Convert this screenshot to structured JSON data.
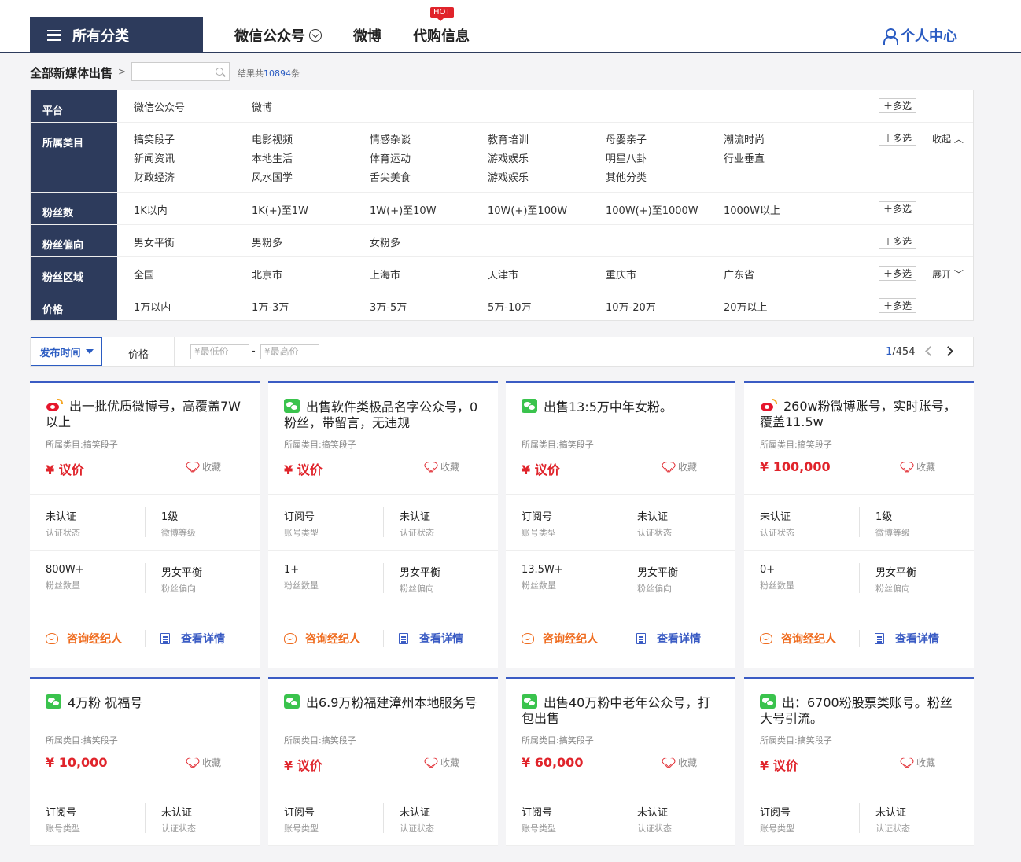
{
  "nav": {
    "all_categories": "所有分类",
    "items": [
      "微信公众号",
      "微博",
      "代购信息"
    ],
    "hot_badge": "HOT",
    "user_center": "个人中心"
  },
  "breadcrumb": {
    "title": "全部新媒体出售",
    "arrow": ">",
    "search_placeholder": "",
    "result_prefix": "结果共",
    "result_count": "10894",
    "result_suffix": "条"
  },
  "filters": {
    "multi_label": "多选",
    "collapse_label": "收起",
    "expand_label": "展开",
    "platform": {
      "label": "平台",
      "options": [
        "微信公众号",
        "微博"
      ]
    },
    "category": {
      "label": "所属类目",
      "options": [
        "搞笑段子",
        "电影视频",
        "情感杂谈",
        "教育培训",
        "母婴亲子",
        "潮流时尚",
        "新闻资讯",
        "本地生活",
        "体育运动",
        "游戏娱乐",
        "明星八卦",
        "行业垂直",
        "财政经济",
        "风水国学",
        "舌尖美食",
        "游戏娱乐",
        "其他分类"
      ]
    },
    "fans": {
      "label": "粉丝数",
      "options": [
        "1K以内",
        "1K(+)至1W",
        "1W(+)至10W",
        "10W(+)至100W",
        "100W(+)至1000W",
        "1000W以上"
      ]
    },
    "gender": {
      "label": "粉丝偏向",
      "options": [
        "男女平衡",
        "男粉多",
        "女粉多"
      ]
    },
    "region": {
      "label": "粉丝区域",
      "options": [
        "全国",
        "北京市",
        "上海市",
        "天津市",
        "重庆市",
        "广东省"
      ]
    },
    "price": {
      "label": "价格",
      "options": [
        "1万以内",
        "1万-3万",
        "3万-5万",
        "5万-10万",
        "10万-20万",
        "20万以上"
      ]
    }
  },
  "sortbar": {
    "sort_label": "发布时间",
    "price_label": "价格",
    "min_placeholder": "¥最低价",
    "max_placeholder": "¥最高价",
    "dash": "-",
    "page_current": "1",
    "page_total": "/454"
  },
  "card_labels": {
    "favorite": "收藏",
    "consult": "咨询经纪人",
    "detail": "查看详情"
  },
  "cards": [
    {
      "platform_icon": "weibo-icon",
      "title": "出一批优质微博号，高覆盖7W以上",
      "category": "所属类目:搞笑段子",
      "price": "¥ 议价",
      "attrs": [
        [
          "未认证",
          "认证状态"
        ],
        [
          "1级",
          "微博等级"
        ],
        [
          "800W+",
          "粉丝数量"
        ],
        [
          "男女平衡",
          "粉丝偏向"
        ]
      ]
    },
    {
      "platform_icon": "wechat-icon",
      "title": "出售软件类极品名字公众号，0粉丝，带留言，无违规",
      "category": "所属类目:搞笑段子",
      "price": "¥ 议价",
      "attrs": [
        [
          "订阅号",
          "账号类型"
        ],
        [
          "未认证",
          "认证状态"
        ],
        [
          "1+",
          "粉丝数量"
        ],
        [
          "男女平衡",
          "粉丝偏向"
        ]
      ]
    },
    {
      "platform_icon": "wechat-icon",
      "title": "出售13:5万中年女粉。",
      "category": "所属类目:搞笑段子",
      "price": "¥ 议价",
      "attrs": [
        [
          "订阅号",
          "账号类型"
        ],
        [
          "未认证",
          "认证状态"
        ],
        [
          "13.5W+",
          "粉丝数量"
        ],
        [
          "男女平衡",
          "粉丝偏向"
        ]
      ]
    },
    {
      "platform_icon": "weibo-icon",
      "title": "260w粉微博账号，实时账号，覆盖11.5w",
      "category": "所属类目:搞笑段子",
      "price": "¥ 100,000",
      "attrs": [
        [
          "未认证",
          "认证状态"
        ],
        [
          "1级",
          "微博等级"
        ],
        [
          "0+",
          "粉丝数量"
        ],
        [
          "男女平衡",
          "粉丝偏向"
        ]
      ]
    },
    {
      "platform_icon": "wechat-icon",
      "title": "4万粉 祝福号",
      "category": "所属类目:搞笑段子",
      "price": "¥ 10,000",
      "attrs": [
        [
          "订阅号",
          "账号类型"
        ],
        [
          "未认证",
          "认证状态"
        ]
      ]
    },
    {
      "platform_icon": "wechat-icon",
      "title": "出6.9万粉福建漳州本地服务号",
      "category": "所属类目:搞笑段子",
      "price": "¥ 议价",
      "attrs": [
        [
          "订阅号",
          "账号类型"
        ],
        [
          "未认证",
          "认证状态"
        ]
      ]
    },
    {
      "platform_icon": "wechat-icon",
      "title": "出售40万粉中老年公众号，打包出售",
      "category": "所属类目:搞笑段子",
      "price": "¥ 60,000",
      "attrs": [
        [
          "订阅号",
          "账号类型"
        ],
        [
          "未认证",
          "认证状态"
        ]
      ]
    },
    {
      "platform_icon": "wechat-icon",
      "title": "出：6700粉股票类账号。粉丝大号引流。",
      "category": "所属类目:搞笑段子",
      "price": "¥ 议价",
      "attrs": [
        [
          "订阅号",
          "账号类型"
        ],
        [
          "未认证",
          "认证状态"
        ]
      ]
    }
  ],
  "colors": {
    "navy": "#2d3b5c",
    "accent_blue": "#2b5cc2",
    "price_red": "#e0242b",
    "agent_orange": "#ef6c1f"
  }
}
